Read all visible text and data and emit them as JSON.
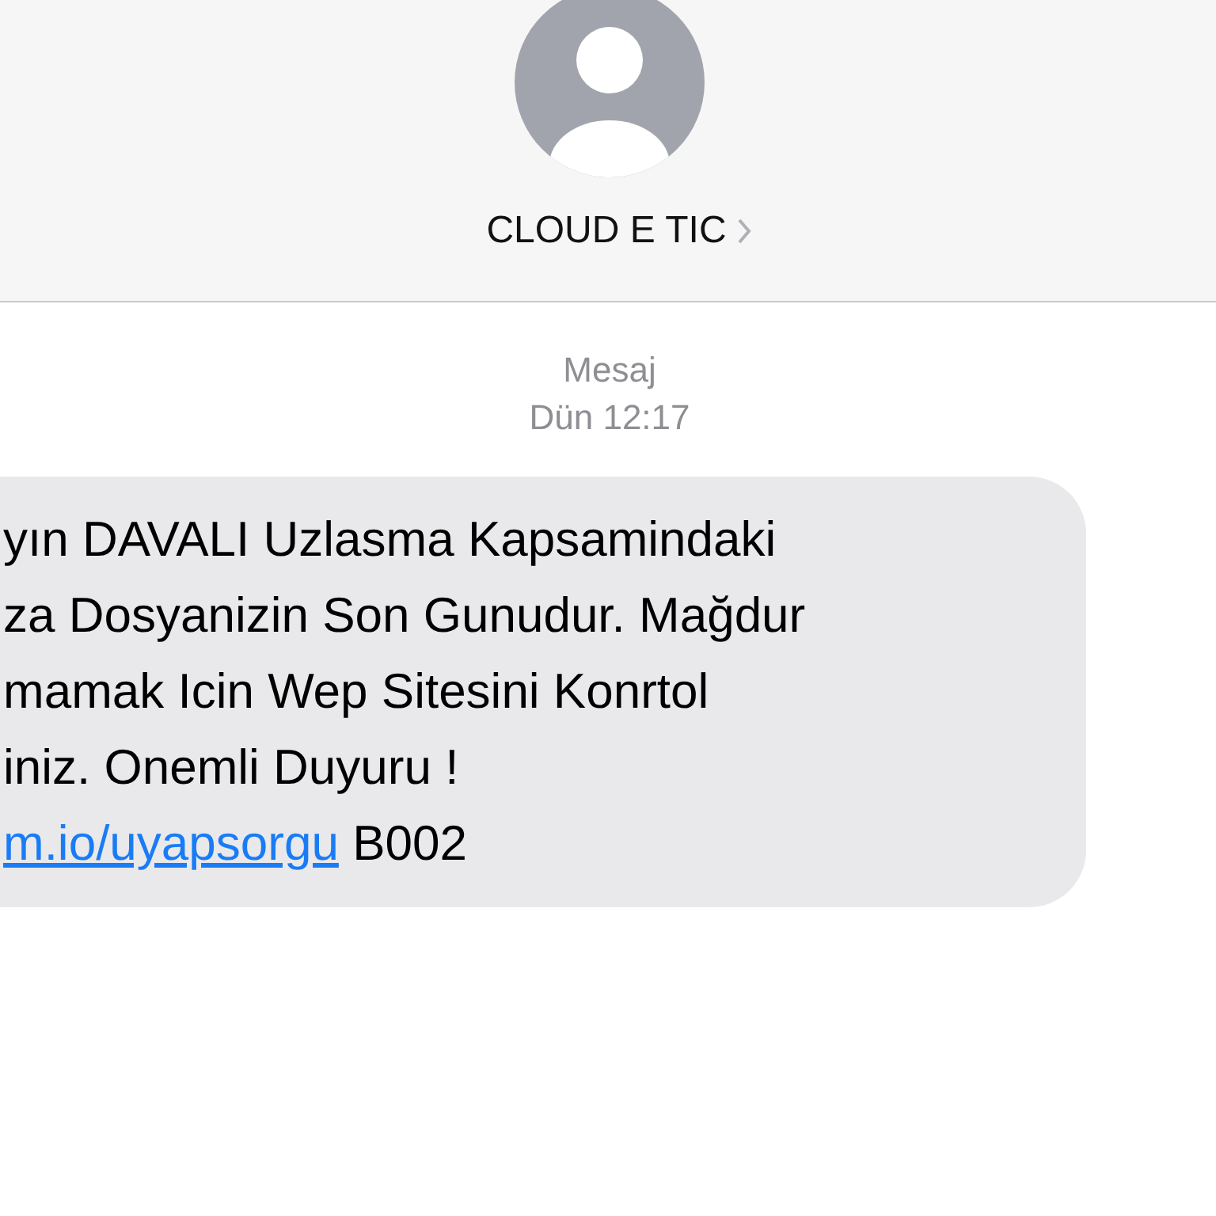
{
  "contact": {
    "name": "CLOUD E TIC"
  },
  "timestamp": {
    "label": "Mesaj",
    "time": "Dün 12:17"
  },
  "message": {
    "lines": [
      {
        "parts": [
          {
            "kind": "text",
            "text": "yın DAVALI Uzlasma Kapsamindaki"
          }
        ]
      },
      {
        "parts": [
          {
            "kind": "text",
            "text": "za Dosyanizin Son Gunudur. Mağdur"
          }
        ]
      },
      {
        "parts": [
          {
            "kind": "text",
            "text": "mamak Icin Wep Sitesini Konrtol"
          }
        ]
      },
      {
        "parts": [
          {
            "kind": "text",
            "text": "iniz. Onemli Duyuru !"
          }
        ]
      },
      {
        "parts": [
          {
            "kind": "link",
            "text": "m.io/uyapsorgu"
          },
          {
            "kind": "text",
            "text": " B002"
          }
        ]
      }
    ]
  }
}
